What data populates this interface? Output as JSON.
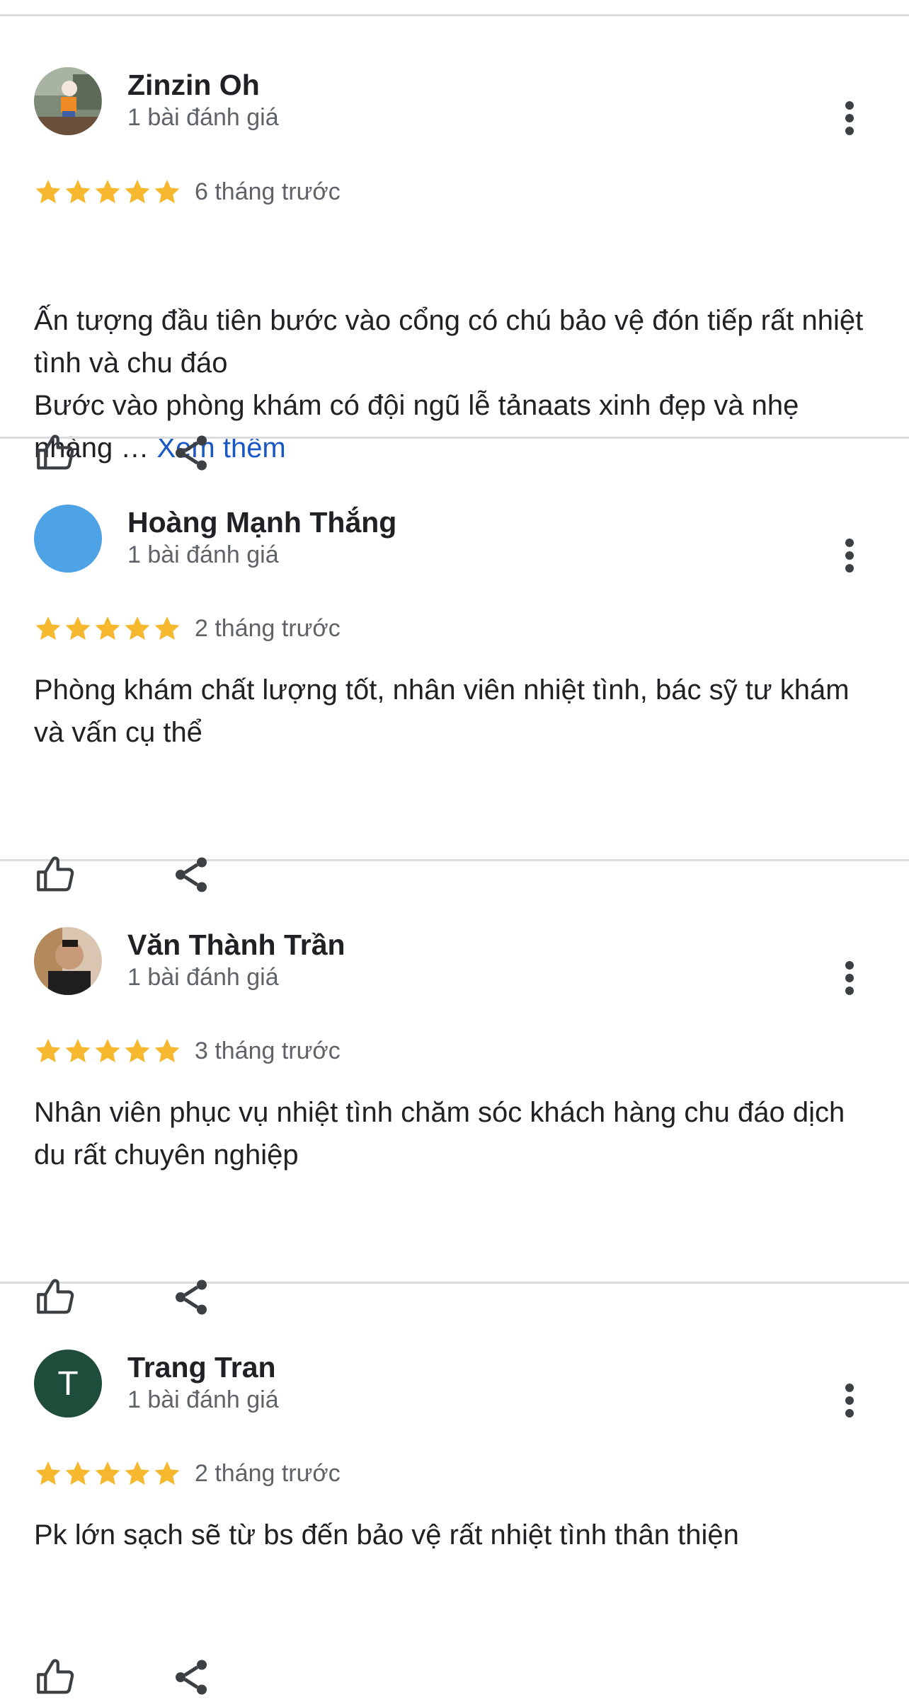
{
  "reviews": [
    {
      "name": "Zinzin Oh",
      "count_label": "1 bài đánh giá",
      "rating": 5,
      "time": "6 tháng trước",
      "text": "Ấn tượng đầu tiên bước vào cổng có chú bảo vệ đón tiếp rất nhiệt tình và chu đáo\nBước vào phòng khám có đội ngũ lễ tảnaats xinh đẹp và nhẹ nhàng …",
      "more_label": "Xem thêm",
      "avatar": {
        "type": "photo",
        "icon": "user-photo-icon",
        "color": "#6b7a6a"
      }
    },
    {
      "name": "Hoàng Mạnh Thắng",
      "count_label": "1 bài đánh giá",
      "rating": 5,
      "time": "2 tháng trước",
      "text": "Phòng khám chất lượng tốt, nhân viên nhiệt tình, bác sỹ tư khám và vấn cụ thể",
      "avatar": {
        "type": "color",
        "color": "#4ea3e6"
      }
    },
    {
      "name": "Văn Thành Trần",
      "count_label": "1 bài đánh giá",
      "rating": 5,
      "time": "3 tháng trước",
      "text": "Nhân viên phục vụ nhiệt tình chăm sóc khách hàng chu đáo dịch du rất chuyên nghiệp",
      "avatar": {
        "type": "photo",
        "icon": "user-photo-icon",
        "color": "#3a3530"
      }
    },
    {
      "name": "Trang Tran",
      "count_label": "1 bài đánh giá",
      "rating": 5,
      "time": "2 tháng trước",
      "text": "Pk lớn sạch sẽ từ bs đến bảo vệ rất nhiệt tình thân thiện",
      "avatar": {
        "type": "letter",
        "letter": "T",
        "color": "#1e4d3a"
      }
    }
  ],
  "colors": {
    "star": "#f5b82e",
    "link": "#1a57c6",
    "divider": "#dadce0"
  }
}
